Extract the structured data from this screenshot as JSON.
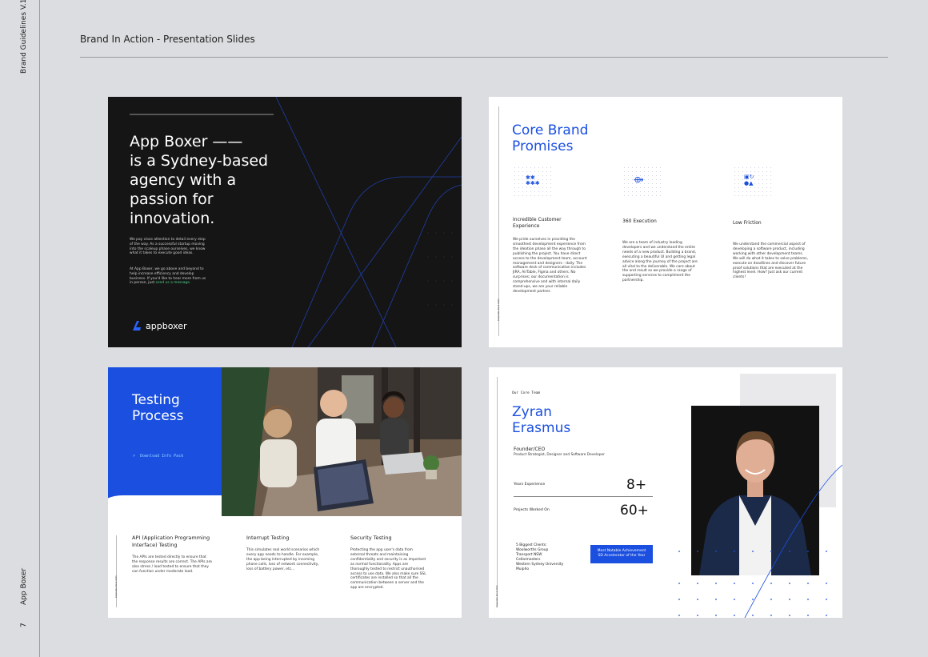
{
  "sidebar": {
    "brand": "Brand Guidelines V.1",
    "app": "App Boxer",
    "page": "7"
  },
  "header": {
    "title": "Brand In Action - Presentation Slides"
  },
  "slide1": {
    "headline": "App Boxer ——\nis a Sydney-based agency with a passion for innovation.",
    "para1": "We pay close attention to detail every step of the way. As a successful startup moving into the scaleup phase ourselves, we know what it takes to execute good ideas.",
    "para2_pre": "At App Boxer, we go above and beyond to help increase efficiency and develop business. If you'd like to hear more from us in person, just ",
    "para2_link": "send us a message.",
    "logo_word": "appboxer"
  },
  "slide2": {
    "title": "Core Brand Promises",
    "side_label": "Corporate Deck 2021",
    "columns": [
      {
        "icon": "asterisks-icon",
        "glyph": "✱✱\n✱✱✱",
        "title": "Incredible Customer Experience",
        "body": "We pride ourselves in providing the smoothest development experience from the ideation phase all the way through to publishing the project. You have direct access to the development team, account management and designers - daily. The software deck of communication includes JIRA, AirTable, Figma and others. No surprises; our documentation is comprehensive and with internal daily stand-ups, we are your reliable development partner."
      },
      {
        "icon": "orbit-icon",
        "glyph": "⟴",
        "title": "360 Execution",
        "body": "We are a team of industry leading developers and we understand the entire needs of a new product. Building a brand, executing a beautiful UI and getting legal advice along the journey of the project are all vital to the deliverable. We care about the end result so we provide a range of supporting services to compliment the partnership."
      },
      {
        "icon": "shapes-icon",
        "glyph": "▣↻\n●▲",
        "title": "Low Friction",
        "body": "We understand the commercial aspect of developing a software product, including working with other development teams. We will do what it takes to solve problems, execute on deadlines and discover future proof solutions that are executed at the highest level. How? Just ask our current clients!"
      }
    ]
  },
  "slide3": {
    "title": "Testing Process",
    "download": "Download Info Pack",
    "side_label": "Corporate Deck 2021",
    "columns": [
      {
        "title": "API (Application Programming Interface) Testing",
        "body": "The APIs are tested directly to ensure that the response results are correct. The APIs are also stress / load tested to ensure that they can function under moderate load."
      },
      {
        "title": "Interrupt Testing",
        "body": "This simulates real world scenarios which every app needs to handle. For example, the app being interrupted by incoming phone calls, loss of network connectivity, loss of battery power, etc..."
      },
      {
        "title": "Security Testing",
        "body": "Protecting the app user's data from external threats and maintaining confidentiality and security is as important as normal functionality. Apps are thoroughly tested to restrict unauthorised access to use data. We also make sure SSL certificates are installed so that all the communication between a server and the app are encrypted."
      }
    ]
  },
  "slide4": {
    "eyebrow": "Our Core Team",
    "name": "Zyran Erasmus",
    "role": "Founder/CEO",
    "role_sub": "Product Strategist, Designer and Software Developer",
    "side_label": "Corporate Deck 2021",
    "stats": [
      {
        "label": "Years Experience",
        "value": "8+"
      },
      {
        "label": "Projects Worked On",
        "value": "60+"
      }
    ],
    "clients": "5 Biggest Clients:\nWoolworths Group\nTransport NSW\nCellarmasters\nWestern Sydney University\nMuipho",
    "badge": "Most Notable Achievement\nSD Accelerator of the Year"
  },
  "colors": {
    "accent": "#1a4fe0",
    "dark": "#151515",
    "link": "#4fd18b"
  }
}
